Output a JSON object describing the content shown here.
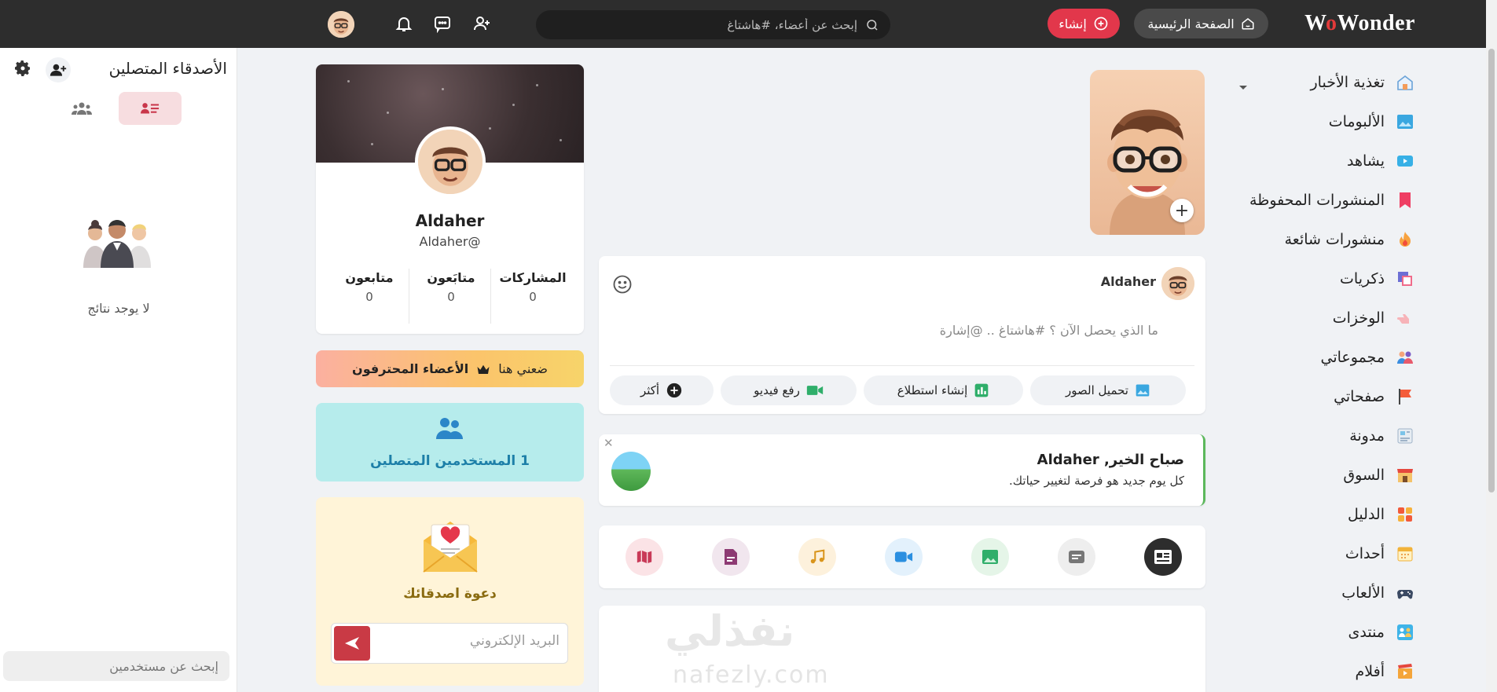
{
  "brand": {
    "logo_text_a": "W",
    "logo_text_o": "o",
    "logo_text_b": "Wonder"
  },
  "header": {
    "home_label": "الصفحة الرئيسية",
    "create_label": "إنشاء",
    "search_placeholder": "إبحث عن أعضاء، #هاشتاغ"
  },
  "nav": {
    "items": [
      {
        "label": "تغذية الأخبار",
        "icon": "house-icon"
      },
      {
        "label": "الألبومات",
        "icon": "album-icon"
      },
      {
        "label": "يشاهد",
        "icon": "watch-icon"
      },
      {
        "label": "المنشورات المحفوظة",
        "icon": "bookmark-icon"
      },
      {
        "label": "منشورات شائعة",
        "icon": "fire-icon"
      },
      {
        "label": "ذكريات",
        "icon": "memories-icon"
      },
      {
        "label": "الوخزات",
        "icon": "poke-icon"
      },
      {
        "label": "مجموعاتي",
        "icon": "groups-icon"
      },
      {
        "label": "صفحاتي",
        "icon": "flag-icon"
      },
      {
        "label": "مدونة",
        "icon": "blog-icon"
      },
      {
        "label": "السوق",
        "icon": "market-icon"
      },
      {
        "label": "الدليل",
        "icon": "directory-icon"
      },
      {
        "label": "أحداث",
        "icon": "calendar-icon"
      },
      {
        "label": "الألعاب",
        "icon": "gamepad-icon"
      },
      {
        "label": "منتدى",
        "icon": "forum-icon"
      },
      {
        "label": "أفلام",
        "icon": "movies-icon"
      }
    ]
  },
  "composer": {
    "user_name": "Aldaher",
    "placeholder": "ما الذي يحصل الآن ؟ #هاشتاغ .. @إشارة",
    "actions": {
      "photos": "تحميل الصور",
      "poll": "إنشاء استطلاع",
      "video": "رفع فيديو",
      "more": "أكثر"
    }
  },
  "greeting": {
    "title": "صباح الخير, Aldaher",
    "subtitle": "كل يوم جديد هو فرصة لتغيير حياتك."
  },
  "watermark": {
    "arabic": "نفذلي",
    "latin": "nafezly.com"
  },
  "profile": {
    "name": "Aldaher",
    "handle": "Aldaher@",
    "stats": [
      {
        "label": "المشاركات",
        "value": "0"
      },
      {
        "label": "متابَعون",
        "value": "0"
      },
      {
        "label": "متابعون",
        "value": "0"
      }
    ]
  },
  "pro_banner": {
    "label": "الأعضاء المحترفون",
    "cta": "ضعني هنا"
  },
  "online_users": {
    "label": "1 المستخدمين المتصلين"
  },
  "invite": {
    "title": "دعوة اصدقائك",
    "email_placeholder": "البريد الإلكتروني"
  },
  "online_friends": {
    "title": "الأصدقاء المتصلين",
    "empty_text": "لا يوجد نتائج",
    "search_placeholder": "إبحث عن مستخدمين"
  },
  "colors": {
    "topbar": "#2d2d2d",
    "accent_red": "#e2374b",
    "online_box": "#b6ecec",
    "invite_box": "#fff4d8"
  }
}
